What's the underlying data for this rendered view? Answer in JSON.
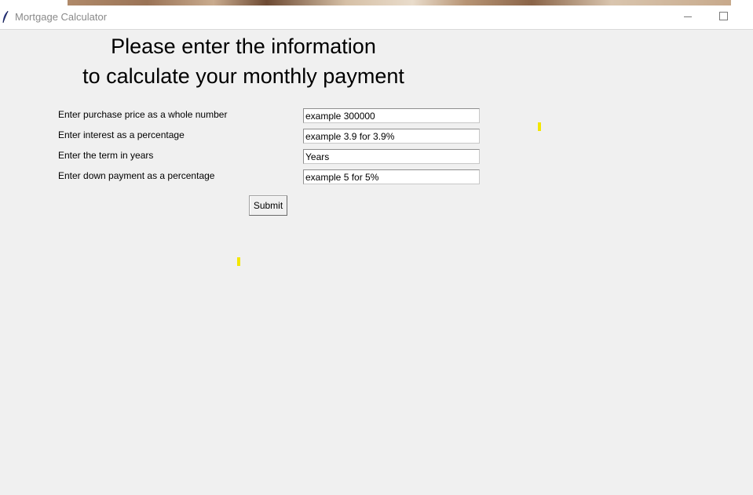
{
  "window": {
    "title": "Mortgage Calculator",
    "app_icon": "feather-icon",
    "minimize_icon": "minimize-icon",
    "maximize_icon": "maximize-icon"
  },
  "heading": {
    "line1": "Please enter the information",
    "line2": "to calculate your monthly payment"
  },
  "form": {
    "fields": [
      {
        "label": "Enter purchase price as a whole number",
        "value": "example 300000"
      },
      {
        "label": "Enter interest as a percentage",
        "value": "example 3.9 for 3.9%"
      },
      {
        "label": "Enter the term in years",
        "value": "Years"
      },
      {
        "label": "Enter down payment as a percentage",
        "value": "example 5 for 5%"
      }
    ],
    "submit_label": "Submit"
  },
  "colors": {
    "window_bg": "#f0f0f0",
    "marker": "#f3e600"
  }
}
